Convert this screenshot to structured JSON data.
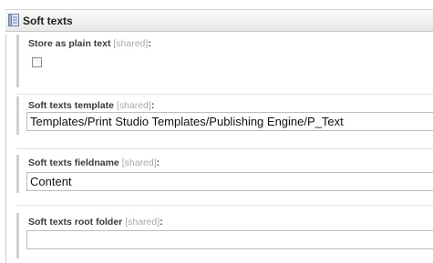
{
  "panel": {
    "title": "Soft texts",
    "icon": "document-icon"
  },
  "fields": [
    {
      "label": "Store as plain text",
      "shared": "[shared]",
      "colon": ":",
      "type": "checkbox",
      "checked": false
    },
    {
      "label": "Soft texts template",
      "shared": "[shared]",
      "colon": ":",
      "type": "text",
      "value": "Templates/Print Studio Templates/Publishing Engine/P_Text"
    },
    {
      "label": "Soft texts fieldname",
      "shared": "[shared]",
      "colon": ":",
      "type": "text",
      "value": "Content"
    },
    {
      "label": "Soft texts root folder",
      "shared": "[shared]",
      "colon": ":",
      "type": "text",
      "value": ""
    }
  ]
}
